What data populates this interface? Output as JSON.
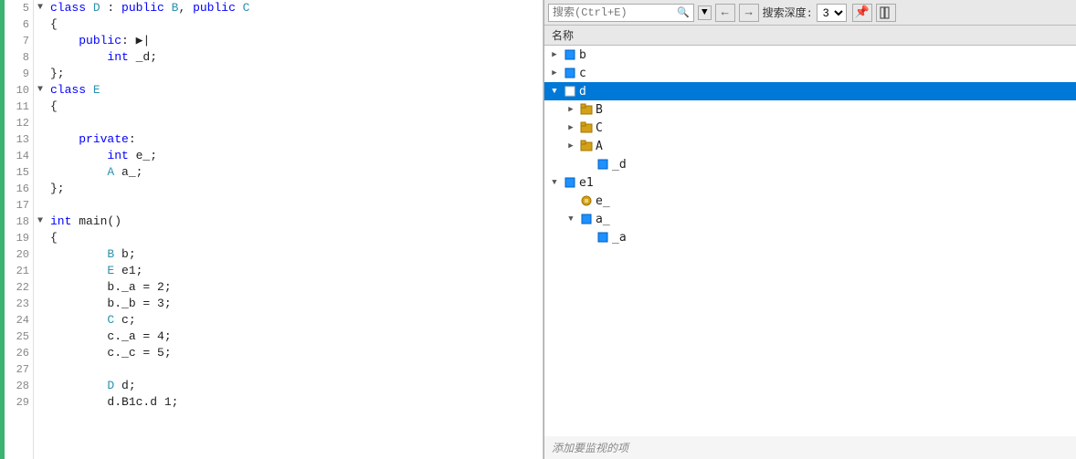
{
  "editor": {
    "lines": [
      {
        "num": "5",
        "fold": "▼",
        "indent": 0,
        "tokens": [
          {
            "type": "kw",
            "text": "class "
          },
          {
            "type": "cls",
            "text": "D"
          },
          {
            "type": "normal",
            "text": " : "
          },
          {
            "type": "kw",
            "text": "public "
          },
          {
            "type": "cls",
            "text": "B"
          },
          {
            "type": "normal",
            "text": ", "
          },
          {
            "type": "kw",
            "text": "public "
          },
          {
            "type": "cls",
            "text": "C"
          }
        ]
      },
      {
        "num": "6",
        "fold": "",
        "indent": 0,
        "tokens": [
          {
            "type": "normal",
            "text": "{"
          }
        ]
      },
      {
        "num": "7",
        "fold": "",
        "indent": 1,
        "tokens": [
          {
            "type": "kw",
            "text": "public"
          },
          {
            "type": "normal",
            "text": ": ▶|"
          }
        ]
      },
      {
        "num": "8",
        "fold": "",
        "indent": 2,
        "tokens": [
          {
            "type": "kw",
            "text": "int"
          },
          {
            "type": "normal",
            "text": " _d;"
          }
        ]
      },
      {
        "num": "9",
        "fold": "",
        "indent": 0,
        "tokens": [
          {
            "type": "normal",
            "text": "};"
          }
        ]
      },
      {
        "num": "10",
        "fold": "▼",
        "indent": 0,
        "tokens": [
          {
            "type": "kw",
            "text": "class "
          },
          {
            "type": "cls",
            "text": "E"
          }
        ]
      },
      {
        "num": "11",
        "fold": "",
        "indent": 0,
        "tokens": [
          {
            "type": "normal",
            "text": "{"
          }
        ]
      },
      {
        "num": "12",
        "fold": "",
        "indent": 0,
        "tokens": [
          {
            "type": "normal",
            "text": ""
          }
        ]
      },
      {
        "num": "13",
        "fold": "",
        "indent": 1,
        "tokens": [
          {
            "type": "kw",
            "text": "private"
          },
          {
            "type": "normal",
            "text": ":"
          }
        ]
      },
      {
        "num": "14",
        "fold": "",
        "indent": 2,
        "tokens": [
          {
            "type": "kw",
            "text": "int"
          },
          {
            "type": "normal",
            "text": " e_;"
          }
        ]
      },
      {
        "num": "15",
        "fold": "",
        "indent": 2,
        "tokens": [
          {
            "type": "cls",
            "text": "A"
          },
          {
            "type": "normal",
            "text": " a_;"
          }
        ]
      },
      {
        "num": "16",
        "fold": "",
        "indent": 0,
        "tokens": [
          {
            "type": "normal",
            "text": "};"
          }
        ]
      },
      {
        "num": "17",
        "fold": "",
        "indent": 0,
        "tokens": [
          {
            "type": "normal",
            "text": ""
          }
        ]
      },
      {
        "num": "18",
        "fold": "▼",
        "indent": 0,
        "tokens": [
          {
            "type": "kw",
            "text": "int"
          },
          {
            "type": "normal",
            "text": " main()"
          }
        ]
      },
      {
        "num": "19",
        "fold": "",
        "indent": 0,
        "tokens": [
          {
            "type": "normal",
            "text": "{"
          }
        ]
      },
      {
        "num": "20",
        "fold": "",
        "indent": 2,
        "tokens": [
          {
            "type": "cls",
            "text": "B"
          },
          {
            "type": "normal",
            "text": " b;"
          }
        ]
      },
      {
        "num": "21",
        "fold": "",
        "indent": 2,
        "tokens": [
          {
            "type": "cls",
            "text": "E"
          },
          {
            "type": "normal",
            "text": " e1;"
          }
        ]
      },
      {
        "num": "22",
        "fold": "",
        "indent": 2,
        "tokens": [
          {
            "type": "normal",
            "text": "b._a = 2;"
          }
        ]
      },
      {
        "num": "23",
        "fold": "",
        "indent": 2,
        "tokens": [
          {
            "type": "normal",
            "text": "b._b = 3;"
          }
        ]
      },
      {
        "num": "24",
        "fold": "",
        "indent": 2,
        "tokens": [
          {
            "type": "cls",
            "text": "C"
          },
          {
            "type": "normal",
            "text": " c;"
          }
        ]
      },
      {
        "num": "25",
        "fold": "",
        "indent": 2,
        "tokens": [
          {
            "type": "normal",
            "text": "c._a = 4;"
          }
        ]
      },
      {
        "num": "26",
        "fold": "",
        "indent": 2,
        "tokens": [
          {
            "type": "normal",
            "text": "c._c = 5;"
          }
        ]
      },
      {
        "num": "27",
        "fold": "",
        "indent": 0,
        "tokens": [
          {
            "type": "normal",
            "text": ""
          }
        ]
      },
      {
        "num": "28",
        "fold": "",
        "indent": 2,
        "tokens": [
          {
            "type": "cls",
            "text": "D"
          },
          {
            "type": "normal",
            "text": " d;"
          }
        ]
      },
      {
        "num": "29",
        "fold": "",
        "indent": 2,
        "tokens": [
          {
            "type": "normal",
            "text": "d.B1c.d 1;"
          }
        ]
      }
    ]
  },
  "watch_panel": {
    "toolbar": {
      "search_placeholder": "搜索(Ctrl+E)",
      "depth_label": "搜索深度:",
      "depth_value": "3",
      "nav_back": "←",
      "nav_forward": "→",
      "pin_icon": "📌"
    },
    "column_header": "名称",
    "tree_items": [
      {
        "id": "b",
        "indent": 1,
        "has_toggle": true,
        "toggle_open": false,
        "icon": "blue-cube",
        "name": "b",
        "selected": false
      },
      {
        "id": "c",
        "indent": 1,
        "has_toggle": true,
        "toggle_open": false,
        "icon": "blue-cube",
        "name": "c",
        "selected": false
      },
      {
        "id": "d",
        "indent": 1,
        "has_toggle": true,
        "toggle_open": true,
        "icon": "blue-cube",
        "name": "d",
        "selected": true
      },
      {
        "id": "B",
        "indent": 2,
        "has_toggle": true,
        "toggle_open": false,
        "icon": "gold-class",
        "name": "B",
        "selected": false
      },
      {
        "id": "C",
        "indent": 2,
        "has_toggle": true,
        "toggle_open": false,
        "icon": "gold-class",
        "name": "C",
        "selected": false
      },
      {
        "id": "A",
        "indent": 2,
        "has_toggle": true,
        "toggle_open": false,
        "icon": "gold-class",
        "name": "A",
        "selected": false
      },
      {
        "id": "_d",
        "indent": 3,
        "has_toggle": false,
        "toggle_open": false,
        "icon": "blue-cube",
        "name": "_d",
        "selected": false
      },
      {
        "id": "e1",
        "indent": 1,
        "has_toggle": true,
        "toggle_open": true,
        "icon": "blue-cube",
        "name": "e1",
        "selected": false
      },
      {
        "id": "e_",
        "indent": 2,
        "has_toggle": false,
        "toggle_open": false,
        "icon": "gold-field",
        "name": "e_",
        "selected": false
      },
      {
        "id": "a_",
        "indent": 2,
        "has_toggle": true,
        "toggle_open": true,
        "icon": "blue-cube",
        "name": "a_",
        "selected": false
      },
      {
        "id": "_a",
        "indent": 3,
        "has_toggle": false,
        "toggle_open": false,
        "icon": "blue-cube",
        "name": "_a",
        "selected": false
      }
    ],
    "add_watch_label": "添加要监视的项"
  }
}
